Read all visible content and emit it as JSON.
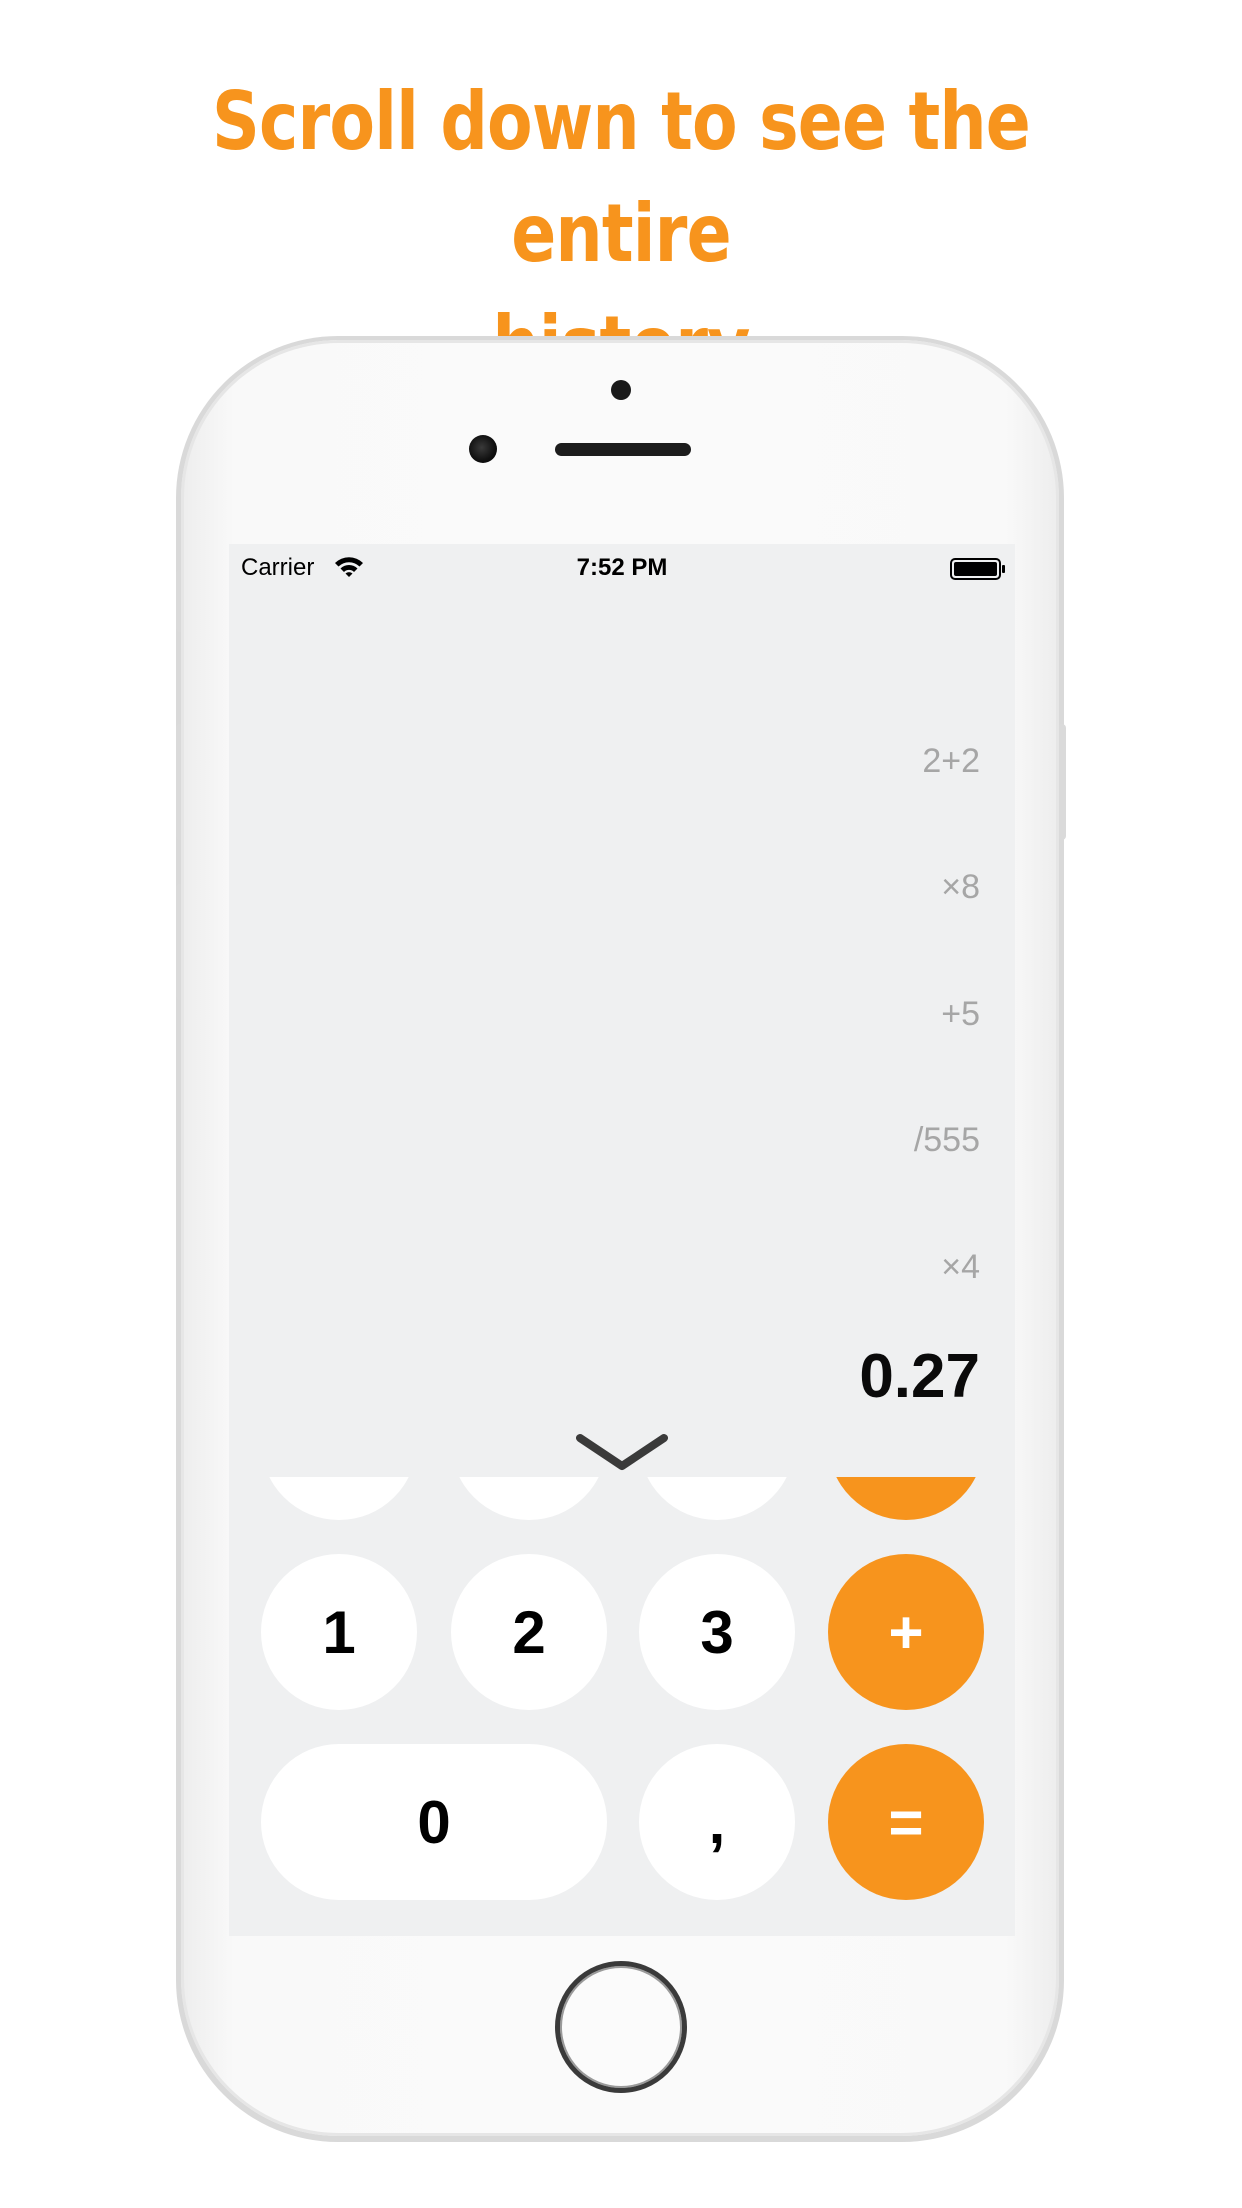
{
  "headline": {
    "line1": "Scroll down to see the entire",
    "line2": "history"
  },
  "colors": {
    "accent": "#f7941d",
    "screen_bg": "#eff0f1",
    "history_text": "#a6a6a6"
  },
  "status_bar": {
    "carrier": "Carrier",
    "time": "7:52 PM",
    "icons": [
      "wifi-icon",
      "battery-icon"
    ]
  },
  "history": [
    "2+2",
    "×8",
    "+5",
    "/555",
    "×4"
  ],
  "display": {
    "result": "0.27"
  },
  "keypad": {
    "partial_row": [
      "",
      "",
      "",
      ""
    ],
    "row1": [
      "1",
      "2",
      "3",
      "+"
    ],
    "row2": [
      "0",
      ",",
      "="
    ]
  }
}
